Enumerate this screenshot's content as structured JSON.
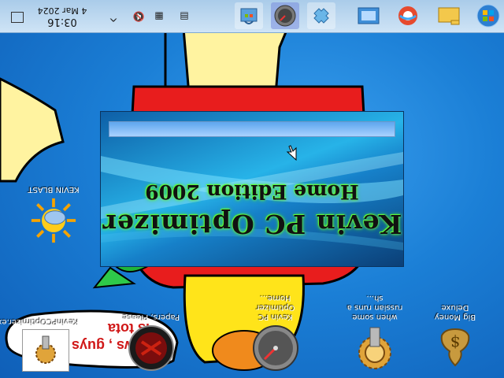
{
  "taskbar": {
    "clock_time": "03:16",
    "clock_date": "4 Mar 2024",
    "tray_icons": [
      "show-desktop-icon",
      "chevron-up-icon",
      "volume-muted-icon",
      "network-icon",
      "file-icon"
    ],
    "pinned_apps": [
      "store-icon",
      "speedometer-icon",
      "gamepad-icon",
      "settings-app-icon",
      "edge-icon",
      "file-explorer-icon",
      "windows-start-icon"
    ]
  },
  "desktop_icons": [
    {
      "label": "Big Money Deluxe",
      "icon": "money-bag-icon"
    },
    {
      "label": "when some russian runs a sh...",
      "icon": "gear-gold-icon"
    },
    {
      "label": "Kevin PC Optimizer Home...",
      "icon": "speedometer-icon"
    },
    {
      "label": "Papers, Please",
      "icon": "papers-please-icon"
    },
    {
      "label": "KevinPCOptimizer.exe",
      "icon": "gear-small-icon"
    },
    {
      "label": "KEVIN BLAST",
      "icon": "sun-cloud-icon"
    }
  ],
  "splash": {
    "title_line1": "Kevin PC Optimizer",
    "title_line2": "Home Edition 2009",
    "progress": 1.0
  },
  "wallpaper": {
    "speech_text_1": "is tota",
    "speech_text_2": "indows , guys"
  },
  "colors": {
    "desktop": "#1b7fd6",
    "taskbar": "#bcd7ef",
    "title_glow": "#5aff3a"
  }
}
